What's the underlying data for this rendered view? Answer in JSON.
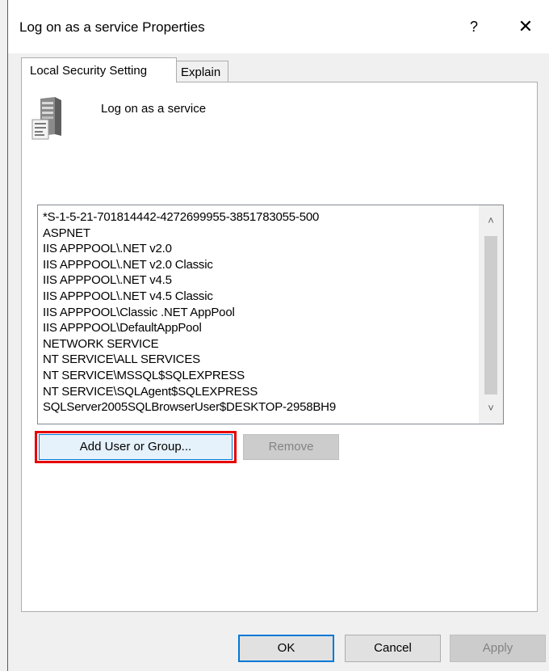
{
  "window": {
    "title": "Log on as a service Properties",
    "help_label": "?",
    "close_label": "✕"
  },
  "tabs": [
    {
      "label": "Local Security Setting",
      "active": true
    },
    {
      "label": "Explain",
      "active": false
    }
  ],
  "policy": {
    "icon": "server-policy-icon",
    "name": "Log on as a service"
  },
  "accounts": {
    "items": [
      "*S-1-5-21-701814442-4272699955-3851783055-500",
      "ASPNET",
      "IIS APPPOOL\\.NET v2.0",
      "IIS APPPOOL\\.NET v2.0 Classic",
      "IIS APPPOOL\\.NET v4.5",
      "IIS APPPOOL\\.NET v4.5 Classic",
      "IIS APPPOOL\\Classic .NET AppPool",
      "IIS APPPOOL\\DefaultAppPool",
      "NETWORK SERVICE",
      "NT SERVICE\\ALL SERVICES",
      "NT SERVICE\\MSSQL$SQLEXPRESS",
      "NT SERVICE\\SQLAgent$SQLEXPRESS",
      "SQLServer2005SQLBrowserUser$DESKTOP-2958BH9"
    ],
    "scroll_up_glyph": "˄",
    "scroll_down_glyph": "˅"
  },
  "actions": {
    "add_label": "Add User or Group...",
    "remove_label": "Remove"
  },
  "footer": {
    "ok_label": "OK",
    "cancel_label": "Cancel",
    "apply_label": "Apply"
  },
  "colors": {
    "highlight": "#e60000",
    "accent": "#0078d7"
  }
}
